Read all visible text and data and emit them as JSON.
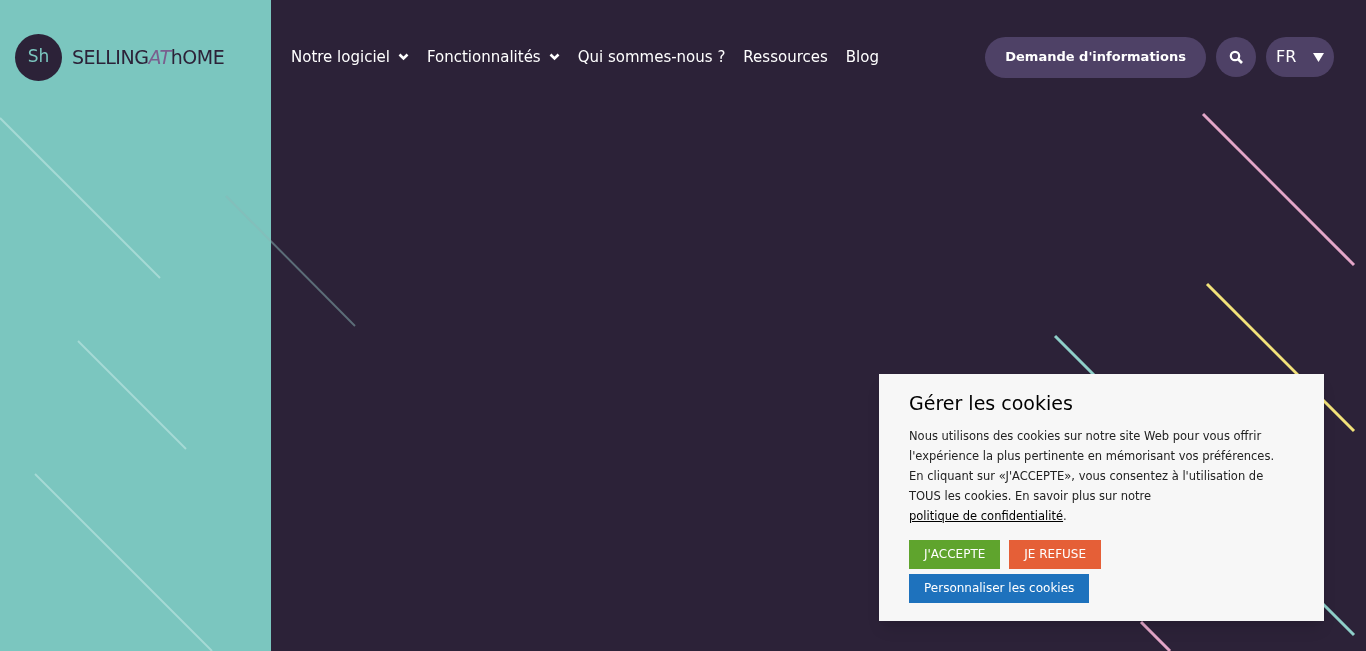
{
  "logo": {
    "mark": "Sh",
    "wordmark": [
      {
        "text": "SELLING",
        "kind": "plain"
      },
      {
        "text": "AT",
        "kind": "accent"
      },
      {
        "text": "hOME",
        "kind": "plain"
      }
    ]
  },
  "nav": [
    {
      "label": "Notre logiciel",
      "has_dropdown": true
    },
    {
      "label": "Fonctionnalités",
      "has_dropdown": true
    },
    {
      "label": "Qui sommes-nous ?",
      "has_dropdown": false
    },
    {
      "label": "Ressources",
      "has_dropdown": false
    },
    {
      "label": "Blog",
      "has_dropdown": false
    }
  ],
  "cta_button": "Demande d'informations",
  "language": "FR",
  "cookie_banner": {
    "title": "Gérer les cookies",
    "text": "Nous utilisons des cookies sur notre site Web pour vous offrir l'expérience la plus pertinente en mémorisant vos préférences. En cliquant sur «J'ACCEPTE», vous consentez à l'utilisation de TOUS les cookies. En savoir plus sur notre ",
    "link": "politique de confidentialité",
    "text_end": ".",
    "buttons": [
      {
        "label": "J'ACCEPTE",
        "kind": "accept"
      },
      {
        "label": "JE REFUSE",
        "kind": "refuse"
      },
      {
        "label": "Personnaliser les cookies",
        "kind": "customize"
      }
    ]
  }
}
